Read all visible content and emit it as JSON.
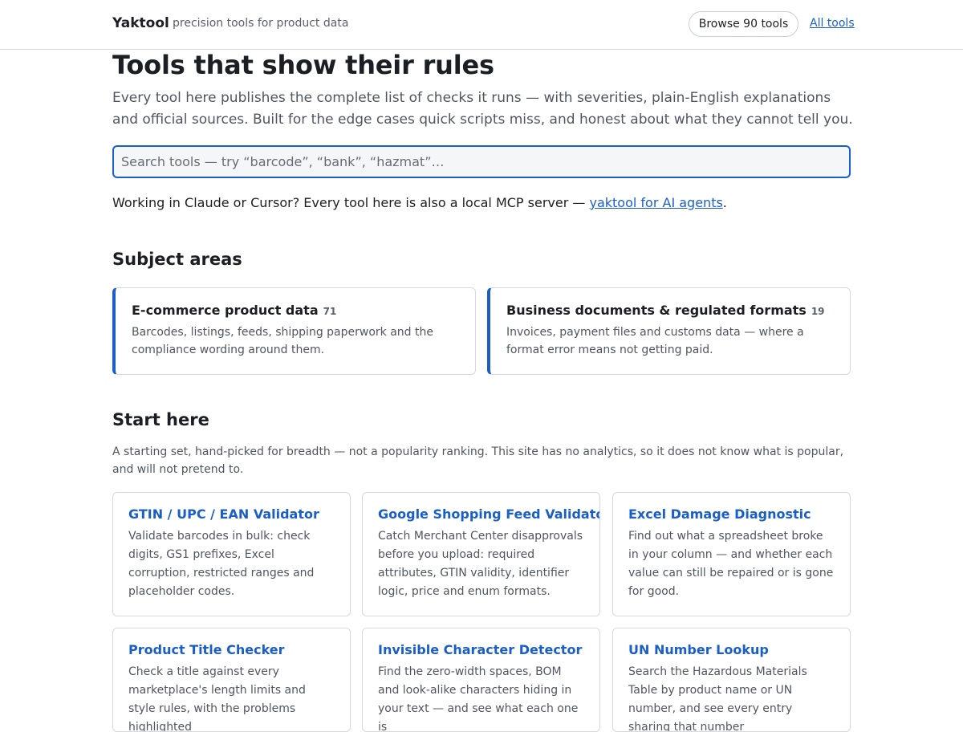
{
  "header": {
    "brand": "Yaktool",
    "tagline": "precision tools for product data",
    "browse_label": "Browse 90 tools",
    "all_tools_label": "All tools"
  },
  "hero": {
    "title": "Tools that show their rules",
    "subtitle": "Every tool here publishes the complete list of checks it runs — with severities, plain-English explanations and official sources. Built for the edge cases quick scripts miss, and honest about what they cannot tell you.",
    "search_placeholder": "Search tools — try “barcode”, “bank”, “hazmat”…",
    "search_value": ""
  },
  "mcp": {
    "text": "Working in Claude or Cursor? Every tool here is also a local MCP server — ",
    "link": "yaktool for AI agents",
    "suffix": "."
  },
  "subject_areas": {
    "heading": "Subject areas",
    "items": [
      {
        "title": "E-commerce product data",
        "count": "71",
        "desc": "Barcodes, listings, feeds, shipping paperwork and the compliance wording around them."
      },
      {
        "title": "Business documents & regulated formats",
        "count": "19",
        "desc": "Invoices, payment files and customs data — where a format error means not getting paid."
      }
    ]
  },
  "start_here": {
    "heading": "Start here",
    "intro": "A starting set, hand-picked for breadth — not a popularity ranking. This site has no analytics, so it does not know what is popular, and will not pretend to.",
    "tools": [
      {
        "title": "GTIN / UPC / EAN Validator",
        "desc": "Validate barcodes in bulk: check digits, GS1 prefixes, Excel corruption, restricted ranges and placeholder codes."
      },
      {
        "title": "Google Shopping Feed Validator",
        "desc": "Catch Merchant Center disapprovals before you upload: required attributes, GTIN validity, identifier logic, price and enum formats."
      },
      {
        "title": "Excel Damage Diagnostic",
        "desc": "Find out what a spreadsheet broke in your column — and whether each value can still be repaired or is gone for good."
      },
      {
        "title": "Product Title Checker",
        "desc": "Check a title against every marketplace's length limits and style rules, with the problems highlighted"
      },
      {
        "title": "Invisible Character Detector",
        "desc": "Find the zero-width spaces, BOM and look-alike characters hiding in your text — and see what each one is"
      },
      {
        "title": "UN Number Lookup",
        "desc": "Search the Hazardous Materials Table by product name or UN number, and see every entry sharing that number"
      }
    ]
  }
}
